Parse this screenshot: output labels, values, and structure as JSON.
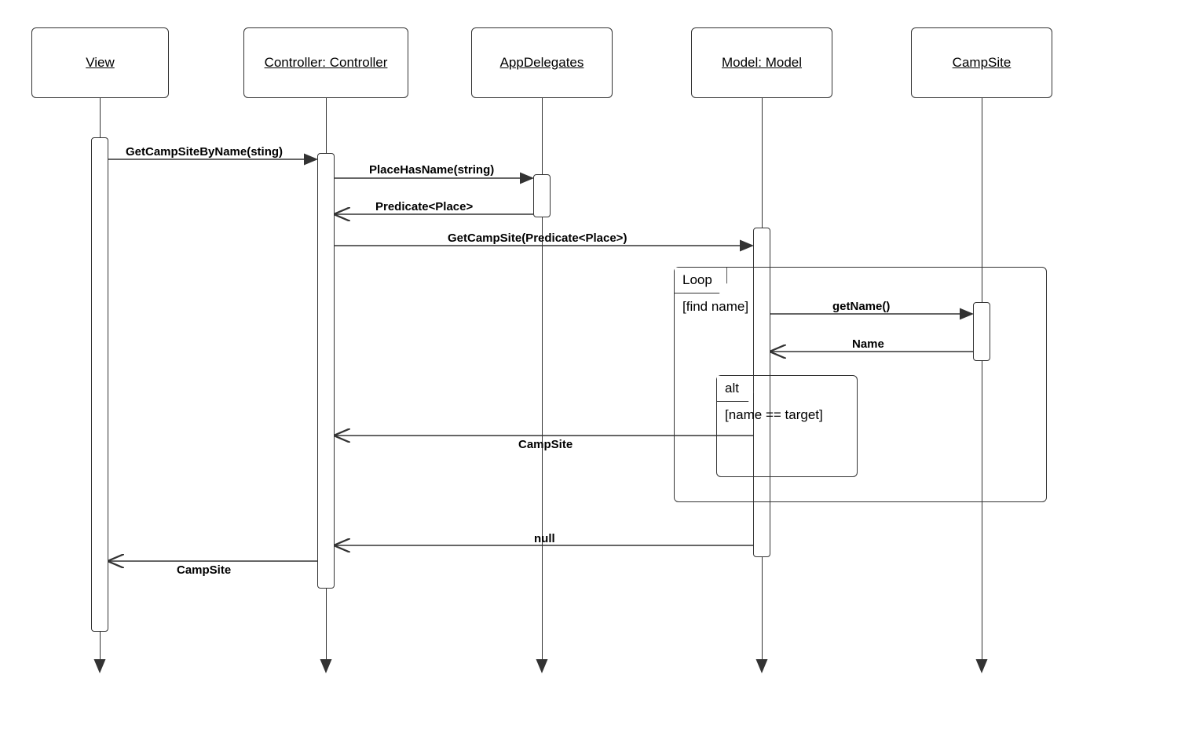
{
  "participants": {
    "view": "View",
    "controller": "Controller: Controller",
    "appdelegates": "AppDelegates",
    "model": "Model: Model",
    "campsite": "CampSite"
  },
  "messages": {
    "m1": "GetCampSiteByName(sting)",
    "m2": "PlaceHasName(string)",
    "m3": "Predicate<Place>",
    "m4": "GetCampSite(Predicate<Place>)",
    "m5": "getName()",
    "m6": "Name",
    "m7": "CampSite",
    "m8": "null",
    "m9": "CampSite"
  },
  "frames": {
    "loop": {
      "title": "Loop",
      "condition": "[find name]"
    },
    "alt": {
      "title": "alt",
      "condition": "[name == target]"
    }
  }
}
